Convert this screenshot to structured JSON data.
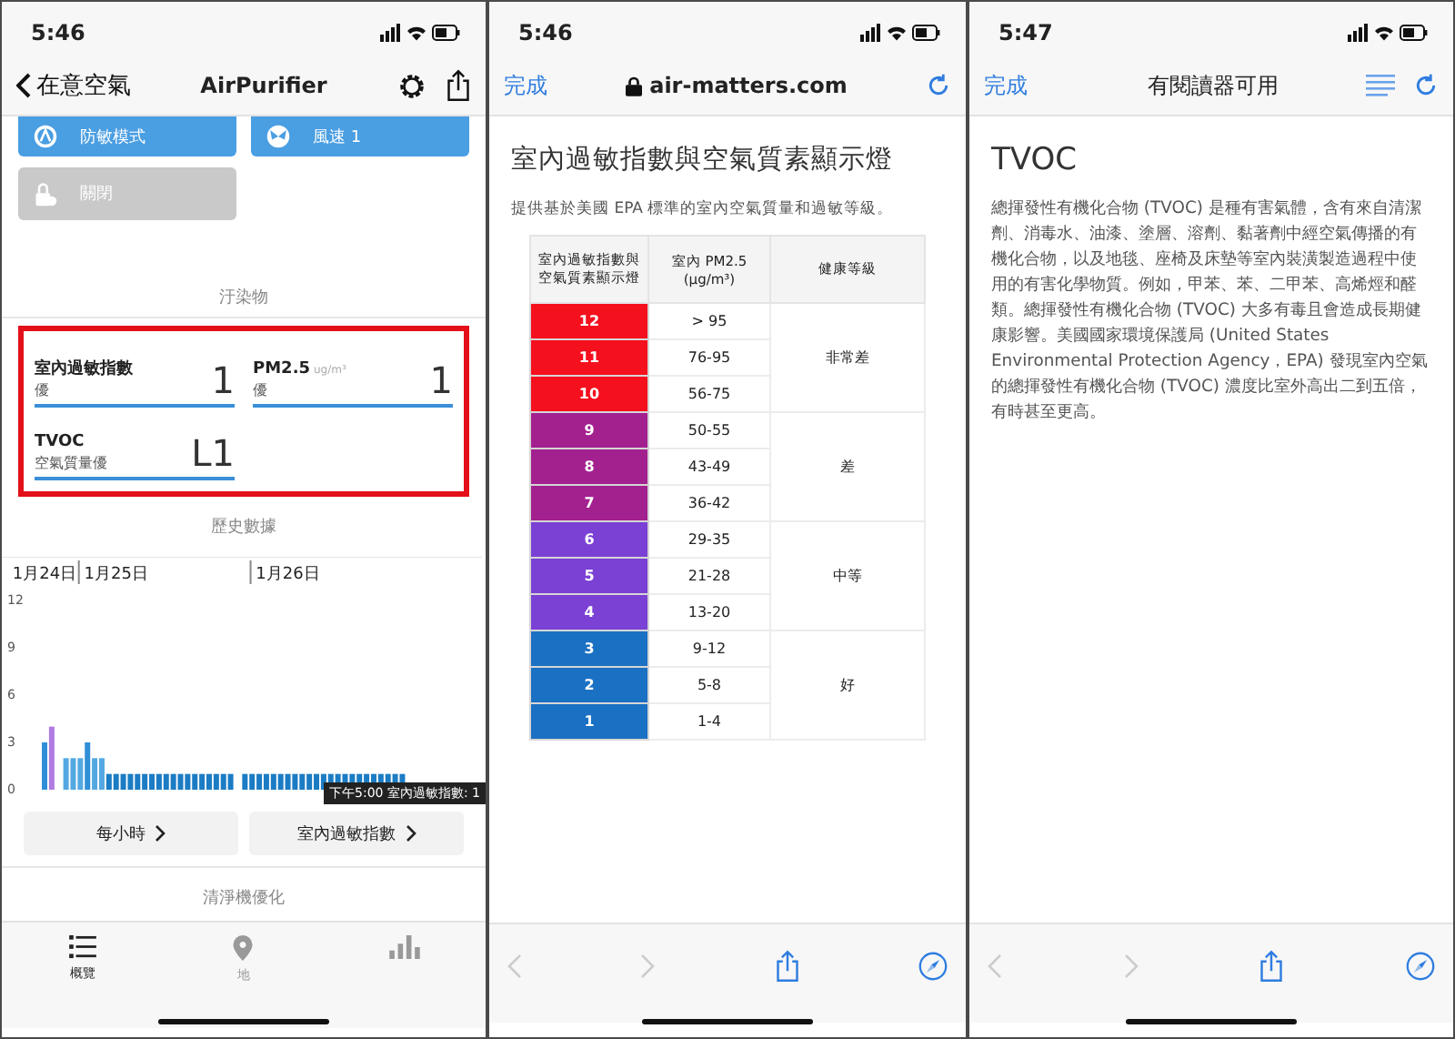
{
  "app_screen": {
    "status_time": "5:46",
    "back_label": "在意空氣",
    "title": "AirPurifier",
    "controls": [
      {
        "kind": "mode",
        "label": "防敏模式",
        "disabled": false
      },
      {
        "kind": "fan",
        "label": "風速 1",
        "disabled": false
      },
      {
        "kind": "lock",
        "label": "關閉",
        "disabled": true
      }
    ],
    "pollutants": {
      "header": "汙染物",
      "highlighted": true,
      "items": [
        {
          "name": "室內過敏指數",
          "grade": "優",
          "value": "1"
        },
        {
          "name": "PM2.5",
          "unit": "ug/m³",
          "grade": "優",
          "value": "1"
        },
        {
          "name": "TVOC",
          "grade": "空氣質量優",
          "value": "L1"
        }
      ]
    },
    "history": {
      "header": "歷史數據",
      "chart_data": {
        "type": "bar",
        "categories": [
          "1月24日",
          null,
          null,
          null,
          null,
          null,
          null,
          null,
          null,
          null,
          "1月25日",
          null,
          null,
          null,
          null,
          null,
          null,
          null,
          null,
          null,
          null,
          null,
          null,
          null,
          null,
          null,
          null,
          null,
          null,
          null,
          null,
          null,
          null,
          null,
          "1月26日",
          null,
          null,
          null,
          null,
          null,
          null,
          null,
          null,
          null,
          null,
          null,
          null,
          null,
          null,
          null,
          null,
          null,
          null,
          null,
          null,
          null,
          null,
          null,
          null,
          null,
          null
        ],
        "values": [
          3,
          4,
          null,
          2,
          2,
          2,
          3,
          2,
          2,
          1,
          1,
          1,
          1,
          1,
          1,
          1,
          1,
          1,
          1,
          1,
          1,
          1,
          1,
          1,
          1,
          1,
          1,
          null,
          1,
          1,
          1,
          1,
          1,
          1,
          1,
          1,
          1,
          1,
          1,
          1,
          1,
          1,
          1,
          1,
          1,
          1,
          1,
          1,
          1,
          1,
          1,
          null,
          null,
          null,
          null,
          null,
          null,
          null,
          null,
          null,
          null
        ],
        "ylim": [
          0,
          12
        ],
        "yticks": [
          0,
          3,
          6,
          9,
          12
        ]
      },
      "tooltip": "下午5:00 室內過敏指數: 1",
      "buttons": [
        "每小時",
        "室內過敏指數"
      ]
    },
    "optimize_header": "清淨機優化",
    "tabs": [
      {
        "kind": "list",
        "label": "概覽",
        "selected": true
      },
      {
        "kind": "pin",
        "label": "地",
        "selected": false
      },
      {
        "kind": "chart",
        "selected": false
      }
    ]
  },
  "web_screen": {
    "status_time": "5:46",
    "done": "完成",
    "address": "air-matters.com",
    "heading": "室內過敏指數與空氣質素顯示燈",
    "intro": "提供基於美國 EPA 標準的室內空氣質量和過敏等級。",
    "columns": [
      "室內過敏指數與空氣質素顯示燈",
      "室內 PM2.5 (µg/m³)",
      "健康等級"
    ],
    "groups": [
      {
        "health": "非常差",
        "color": "#f5101e",
        "rows": [
          {
            "index": "12",
            "pm25": "> 95"
          },
          {
            "index": "11",
            "pm25": "76-95"
          },
          {
            "index": "10",
            "pm25": "56-75"
          }
        ]
      },
      {
        "health": "差",
        "color": "#a3208f",
        "rows": [
          {
            "index": "9",
            "pm25": "50-55"
          },
          {
            "index": "8",
            "pm25": "43-49"
          },
          {
            "index": "7",
            "pm25": "36-42"
          }
        ]
      },
      {
        "health": "中等",
        "color": "#7b40d4",
        "rows": [
          {
            "index": "6",
            "pm25": "29-35"
          },
          {
            "index": "5",
            "pm25": "21-28"
          },
          {
            "index": "4",
            "pm25": "13-20"
          }
        ]
      },
      {
        "health": "好",
        "color": "#1a70c2",
        "rows": [
          {
            "index": "3",
            "pm25": "9-12"
          },
          {
            "index": "2",
            "pm25": "5-8"
          },
          {
            "index": "1",
            "pm25": "1-4"
          }
        ]
      }
    ]
  },
  "reader_screen": {
    "status_time": "5:47",
    "done": "完成",
    "title": "有閱讀器可用",
    "heading": "TVOC",
    "body": "總揮發性有機化合物 (TVOC) 是種有害氣體，含有來自清潔劑、消毒水、油漆、塗層、溶劑、黏著劑中經空氣傳播的有機化合物，以及地毯、座椅及床墊等室內裝潢製造過程中使用的有害化學物質。例如，甲苯、苯、二甲苯、高烯烴和醛類。總揮發性有機化合物 (TVOC) 大多有毒且會造成長期健康影響。美國國家環境保護局 (United States Environmental Protection Agency，EPA) 發現室內空氣的總揮發性有機化合物 (TVOC) 濃度比室外高出二到五倍，有時甚至更高。"
  }
}
